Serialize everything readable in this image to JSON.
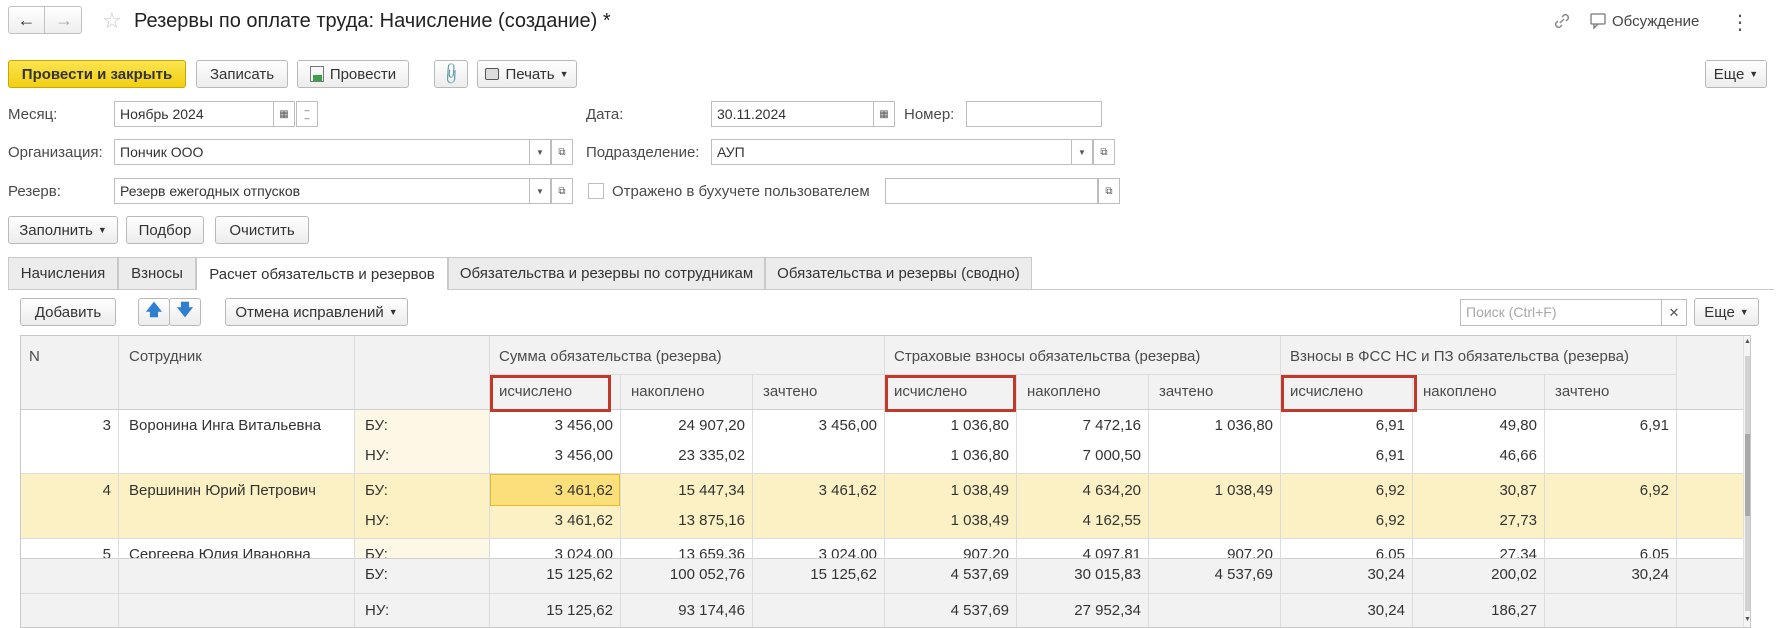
{
  "window": {
    "title": "Резервы по оплате труда: Начисление (создание) *",
    "discussion_label": "Обсуждение"
  },
  "toolbar": {
    "post_close_label": "Провести и закрыть",
    "save_label": "Записать",
    "post_label": "Провести",
    "print_label": "Печать",
    "more_label": "Еще"
  },
  "form": {
    "month_label": "Месяц:",
    "month_value": "Ноябрь 2024",
    "date_label": "Дата:",
    "date_value": "30.11.2024",
    "number_label": "Номер:",
    "number_value": "",
    "org_label": "Организация:",
    "org_value": "Пончик ООО",
    "dept_label": "Подразделение:",
    "dept_value": "АУП",
    "reserve_label": "Резерв:",
    "reserve_value": "Резерв ежегодных отпусков",
    "reflected_label": "Отражено в бухучете пользователем",
    "reflected_value": ""
  },
  "actions": {
    "fill_label": "Заполнить",
    "pick_label": "Подбор",
    "clear_label": "Очистить"
  },
  "tabs": [
    {
      "label": "Начисления"
    },
    {
      "label": "Взносы"
    },
    {
      "label": "Расчет обязательств и резервов"
    },
    {
      "label": "Обязательства и резервы по сотрудникам"
    },
    {
      "label": "Обязательства и резервы (сводно)"
    }
  ],
  "table_toolbar": {
    "add_label": "Добавить",
    "undo_fix_label": "Отмена исправлений",
    "search_placeholder": "Поиск (Ctrl+F)",
    "more_label": "Еще"
  },
  "table": {
    "headers": {
      "n": "N",
      "employee": "Сотрудник",
      "group1": "Сумма обязательства (резерва)",
      "group2": "Страховые взносы обязательства (резерва)",
      "group3": "Взносы в ФСС НС и ПЗ обязательства (резерва)",
      "sub": [
        "исчислено",
        "накоплено",
        "зачтено",
        "исчислено",
        "накоплено",
        "зачтено",
        "исчислено",
        "накоплено",
        "зачтено"
      ]
    },
    "rows": [
      {
        "n": "3",
        "name": "Воронина Инга Витальевна",
        "bu": {
          "type": "БУ:",
          "vals": [
            "3 456,00",
            "24 907,20",
            "3 456,00",
            "1 036,80",
            "7 472,16",
            "1 036,80",
            "6,91",
            "49,80",
            "6,91"
          ]
        },
        "nu": {
          "type": "НУ:",
          "vals": [
            "3 456,00",
            "23 335,02",
            "",
            "1 036,80",
            "7 000,50",
            "",
            "6,91",
            "46,66",
            ""
          ]
        }
      },
      {
        "n": "4",
        "name": "Вершинин Юрий Петрович",
        "bu": {
          "type": "БУ:",
          "vals": [
            "3 461,62",
            "15 447,34",
            "3 461,62",
            "1 038,49",
            "4 634,20",
            "1 038,49",
            "6,92",
            "30,87",
            "6,92"
          ]
        },
        "nu": {
          "type": "НУ:",
          "vals": [
            "3 461,62",
            "13 875,16",
            "",
            "1 038,49",
            "4 162,55",
            "",
            "6,92",
            "27,73",
            ""
          ]
        }
      },
      {
        "n": "5",
        "name": "Сергеева Юлия Ивановна",
        "bu": {
          "type": "БУ:",
          "vals": [
            "3 024,00",
            "13 659,36",
            "3 024,00",
            "907,20",
            "4 097,81",
            "907,20",
            "6,05",
            "27,34",
            "6,05"
          ]
        }
      }
    ],
    "footer": {
      "bu": {
        "type": "БУ:",
        "vals": [
          "15 125,62",
          "100 052,76",
          "15 125,62",
          "4 537,69",
          "30 015,83",
          "4 537,69",
          "30,24",
          "200,02",
          "30,24"
        ]
      },
      "nu": {
        "type": "НУ:",
        "vals": [
          "15 125,62",
          "93 174,46",
          "",
          "4 537,69",
          "27 952,34",
          "",
          "30,24",
          "186,27",
          ""
        ]
      }
    }
  },
  "colors": {
    "accent_yellow": "#f5d21c",
    "selected_row": "#fbf1c4",
    "type_cell": "#fdf8e6",
    "highlight_box": "#c0392b"
  }
}
